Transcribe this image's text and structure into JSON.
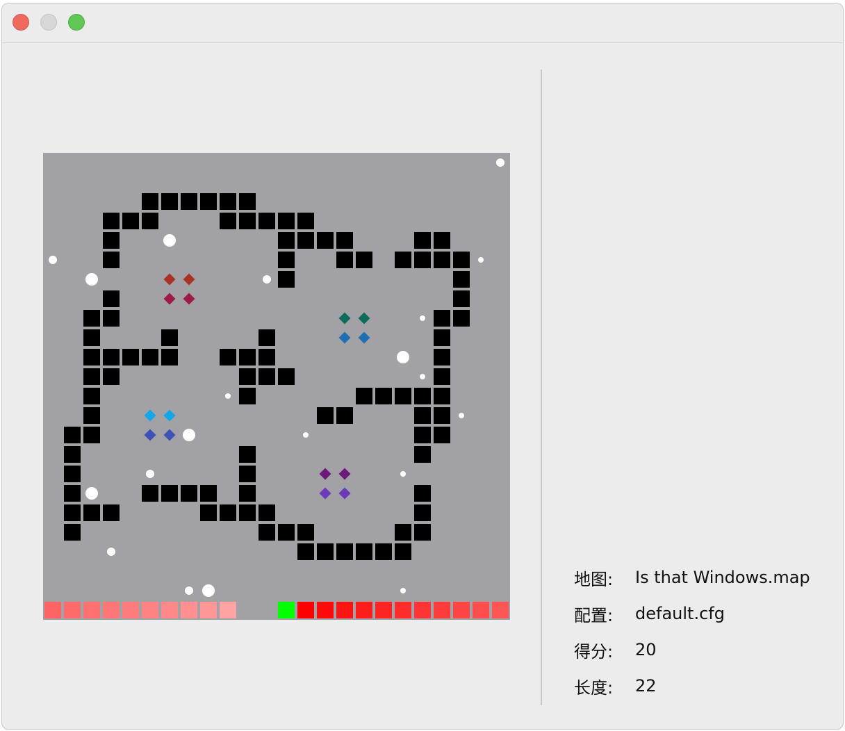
{
  "window": {
    "buttons": [
      "close",
      "minimize",
      "maximize"
    ]
  },
  "info": {
    "map_label": "地图:",
    "map_value": "Is that Windows.map",
    "config_label": "配置:",
    "config_value": "default.cfg",
    "score_label": "得分:",
    "score_value": "20",
    "length_label": "长度:",
    "length_value": "22"
  },
  "game": {
    "colors": {
      "background": "#a2a1a6",
      "wall": "#000000",
      "food": "#ffffff",
      "snake_head": "#00ff00"
    },
    "walls": [
      [
        5,
        2
      ],
      [
        6,
        2
      ],
      [
        7,
        2
      ],
      [
        8,
        2
      ],
      [
        9,
        2
      ],
      [
        10,
        2
      ],
      [
        3,
        3
      ],
      [
        4,
        3
      ],
      [
        5,
        3
      ],
      [
        9,
        3
      ],
      [
        10,
        3
      ],
      [
        11,
        3
      ],
      [
        12,
        3
      ],
      [
        13,
        3
      ],
      [
        3,
        4
      ],
      [
        12,
        4
      ],
      [
        13,
        4
      ],
      [
        14,
        4
      ],
      [
        15,
        4
      ],
      [
        19,
        4
      ],
      [
        20,
        4
      ],
      [
        3,
        5
      ],
      [
        12,
        5
      ],
      [
        15,
        5
      ],
      [
        16,
        5
      ],
      [
        18,
        5
      ],
      [
        19,
        5
      ],
      [
        20,
        5
      ],
      [
        21,
        5
      ],
      [
        12,
        6
      ],
      [
        21,
        6
      ],
      [
        3,
        7
      ],
      [
        21,
        7
      ],
      [
        2,
        8
      ],
      [
        3,
        8
      ],
      [
        20,
        8
      ],
      [
        21,
        8
      ],
      [
        2,
        9
      ],
      [
        6,
        9
      ],
      [
        11,
        9
      ],
      [
        20,
        9
      ],
      [
        2,
        10
      ],
      [
        3,
        10
      ],
      [
        4,
        10
      ],
      [
        5,
        10
      ],
      [
        6,
        10
      ],
      [
        9,
        10
      ],
      [
        10,
        10
      ],
      [
        11,
        10
      ],
      [
        20,
        10
      ],
      [
        2,
        11
      ],
      [
        3,
        11
      ],
      [
        10,
        11
      ],
      [
        11,
        11
      ],
      [
        12,
        11
      ],
      [
        20,
        11
      ],
      [
        2,
        12
      ],
      [
        10,
        12
      ],
      [
        16,
        12
      ],
      [
        17,
        12
      ],
      [
        18,
        12
      ],
      [
        19,
        12
      ],
      [
        20,
        12
      ],
      [
        2,
        13
      ],
      [
        14,
        13
      ],
      [
        15,
        13
      ],
      [
        19,
        13
      ],
      [
        20,
        13
      ],
      [
        1,
        14
      ],
      [
        2,
        14
      ],
      [
        19,
        14
      ],
      [
        20,
        14
      ],
      [
        1,
        15
      ],
      [
        10,
        15
      ],
      [
        19,
        15
      ],
      [
        1,
        16
      ],
      [
        10,
        16
      ],
      [
        1,
        17
      ],
      [
        5,
        17
      ],
      [
        6,
        17
      ],
      [
        7,
        17
      ],
      [
        8,
        17
      ],
      [
        10,
        17
      ],
      [
        19,
        17
      ],
      [
        1,
        18
      ],
      [
        2,
        18
      ],
      [
        3,
        18
      ],
      [
        8,
        18
      ],
      [
        9,
        18
      ],
      [
        10,
        18
      ],
      [
        11,
        18
      ],
      [
        19,
        18
      ],
      [
        1,
        19
      ],
      [
        11,
        19
      ],
      [
        12,
        19
      ],
      [
        13,
        19
      ],
      [
        18,
        19
      ],
      [
        19,
        19
      ],
      [
        13,
        20
      ],
      [
        14,
        20
      ],
      [
        15,
        20
      ],
      [
        16,
        20
      ],
      [
        17,
        20
      ],
      [
        18,
        20
      ]
    ],
    "gem_groups": [
      {
        "col": 6,
        "row": 6,
        "top_color": "#a83224",
        "bottom_color": "#9e1b45"
      },
      {
        "col": 15,
        "row": 8,
        "top_color": "#0f6b5c",
        "bottom_color": "#1f6fb3"
      },
      {
        "col": 5,
        "row": 13,
        "top_color": "#12a6ea",
        "bottom_color": "#3f51b5"
      },
      {
        "col": 14,
        "row": 16,
        "top_color": "#6a1b7a",
        "bottom_color": "#6a3ab8"
      }
    ],
    "food": [
      {
        "col": 23,
        "row": 0,
        "size": "small"
      },
      {
        "col": 6,
        "row": 4,
        "size": "big"
      },
      {
        "col": 0,
        "row": 5,
        "size": "small"
      },
      {
        "col": 22,
        "row": 5,
        "size": "tiny"
      },
      {
        "col": 2,
        "row": 6,
        "size": "big"
      },
      {
        "col": 11,
        "row": 6,
        "size": "small"
      },
      {
        "col": 19,
        "row": 8,
        "size": "tiny"
      },
      {
        "col": 18,
        "row": 10,
        "size": "big"
      },
      {
        "col": 19,
        "row": 11,
        "size": "tiny"
      },
      {
        "col": 9,
        "row": 12,
        "size": "tiny"
      },
      {
        "col": 21,
        "row": 13,
        "size": "tiny"
      },
      {
        "col": 7,
        "row": 14,
        "size": "big"
      },
      {
        "col": 13,
        "row": 14,
        "size": "tiny"
      },
      {
        "col": 5,
        "row": 16,
        "size": "small"
      },
      {
        "col": 18,
        "row": 16,
        "size": "tiny"
      },
      {
        "col": 2,
        "row": 17,
        "size": "big"
      },
      {
        "col": 3,
        "row": 20,
        "size": "small"
      },
      {
        "col": 7,
        "row": 22,
        "size": "small"
      },
      {
        "col": 8,
        "row": 22,
        "size": "big"
      },
      {
        "col": 18,
        "row": 22,
        "size": "tiny"
      }
    ],
    "snakes": [
      {
        "row": 23,
        "segments": [
          {
            "col": 0,
            "color": "#ff6464"
          },
          {
            "col": 1,
            "color": "#ff6a6a"
          },
          {
            "col": 2,
            "color": "#ff7070"
          },
          {
            "col": 3,
            "color": "#ff7676"
          },
          {
            "col": 4,
            "color": "#ff7c7c"
          },
          {
            "col": 5,
            "color": "#ff8383"
          },
          {
            "col": 6,
            "color": "#ff8989"
          },
          {
            "col": 7,
            "color": "#ff9090"
          },
          {
            "col": 8,
            "color": "#ff9797"
          },
          {
            "col": 9,
            "color": "#ffa3a3"
          }
        ]
      },
      {
        "row": 23,
        "segments": [
          {
            "col": 12,
            "color": "#00ff00"
          },
          {
            "col": 13,
            "color": "#ff0000"
          },
          {
            "col": 14,
            "color": "#ff0a0a"
          },
          {
            "col": 15,
            "color": "#ff1414"
          },
          {
            "col": 16,
            "color": "#ff1c1c"
          },
          {
            "col": 17,
            "color": "#ff2424"
          },
          {
            "col": 18,
            "color": "#ff2c2c"
          },
          {
            "col": 19,
            "color": "#ff3434"
          },
          {
            "col": 20,
            "color": "#ff3c3c"
          },
          {
            "col": 21,
            "color": "#ff4444"
          },
          {
            "col": 22,
            "color": "#ff4c4c"
          },
          {
            "col": 23,
            "color": "#ff5454"
          }
        ]
      }
    ]
  }
}
